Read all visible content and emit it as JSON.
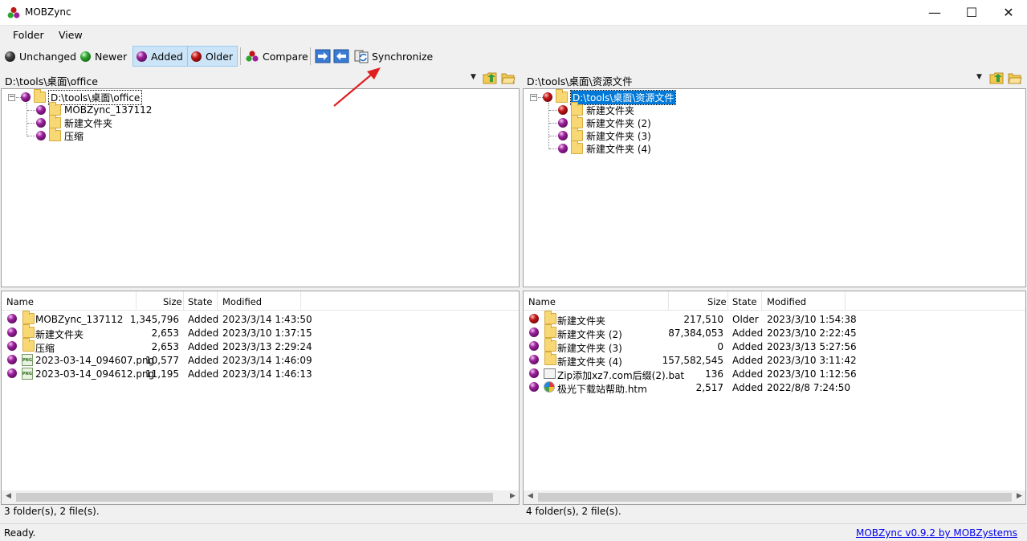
{
  "window": {
    "title": "MOBZync",
    "controls": {
      "minimize": "—",
      "maximize": "☐",
      "close": "✕"
    }
  },
  "menu": {
    "items": [
      "Folder",
      "View"
    ]
  },
  "toolbar": {
    "unchanged": "Unchanged",
    "newer": "Newer",
    "added": "Added",
    "older": "Older",
    "compare": "Compare",
    "synchronize": "Synchronize"
  },
  "left": {
    "path": "D:\\tools\\桌面\\office",
    "tree": {
      "root": "D:\\tools\\桌面\\office",
      "children": [
        "MOBZync_137112",
        "新建文件夹",
        "压缩"
      ]
    },
    "columns": {
      "name": "Name",
      "size": "Size",
      "state": "State",
      "modified": "Modified"
    },
    "rows": [
      {
        "name": "MOBZync_137112",
        "size": "1,345,796",
        "state": "Added",
        "modified": "2023/3/14 1:43:50",
        "type": "folder",
        "status": "added"
      },
      {
        "name": "新建文件夹",
        "size": "2,653",
        "state": "Added",
        "modified": "2023/3/10 1:37:15",
        "type": "folder",
        "status": "added"
      },
      {
        "name": "压缩",
        "size": "2,653",
        "state": "Added",
        "modified": "2023/3/13 2:29:24",
        "type": "folder",
        "status": "added"
      },
      {
        "name": "2023-03-14_094607.png",
        "size": "10,577",
        "state": "Added",
        "modified": "2023/3/14 1:46:09",
        "type": "png",
        "status": "added"
      },
      {
        "name": "2023-03-14_094612.png",
        "size": "11,195",
        "state": "Added",
        "modified": "2023/3/14 1:46:13",
        "type": "png",
        "status": "added"
      }
    ],
    "status": "3 folder(s), 2 file(s)."
  },
  "right": {
    "path": "D:\\tools\\桌面\\资源文件",
    "tree": {
      "root": "D:\\tools\\桌面\\资源文件",
      "children": [
        "新建文件夹",
        "新建文件夹 (2)",
        "新建文件夹 (3)",
        "新建文件夹 (4)"
      ]
    },
    "columns": {
      "name": "Name",
      "size": "Size",
      "state": "State",
      "modified": "Modified"
    },
    "rows": [
      {
        "name": "新建文件夹",
        "size": "217,510",
        "state": "Older",
        "modified": "2023/3/10 1:54:38",
        "type": "folder",
        "status": "older"
      },
      {
        "name": "新建文件夹 (2)",
        "size": "87,384,053",
        "state": "Added",
        "modified": "2023/3/10 2:22:45",
        "type": "folder",
        "status": "added"
      },
      {
        "name": "新建文件夹 (3)",
        "size": "0",
        "state": "Added",
        "modified": "2023/3/13 5:27:56",
        "type": "folder",
        "status": "added"
      },
      {
        "name": "新建文件夹 (4)",
        "size": "157,582,545",
        "state": "Added",
        "modified": "2023/3/10 3:11:42",
        "type": "folder",
        "status": "added"
      },
      {
        "name": "Zip添加xz7.com后缀(2).bat",
        "size": "136",
        "state": "Added",
        "modified": "2023/3/10 1:12:56",
        "type": "bat",
        "status": "added"
      },
      {
        "name": "极光下载站帮助.htm",
        "size": "2,517",
        "state": "Added",
        "modified": "2022/8/8 7:24:50",
        "type": "htm",
        "status": "added"
      }
    ],
    "status": "4 folder(s), 2 file(s)."
  },
  "statusbar": {
    "ready": "Ready.",
    "credit": "MOBZync v0.9.2 by MOBZystems"
  },
  "colors": {
    "added": "#9b1f9b",
    "older": "#c01818",
    "newer": "#2fa52f",
    "unchanged": "#000000",
    "selection": "#0078d7"
  }
}
